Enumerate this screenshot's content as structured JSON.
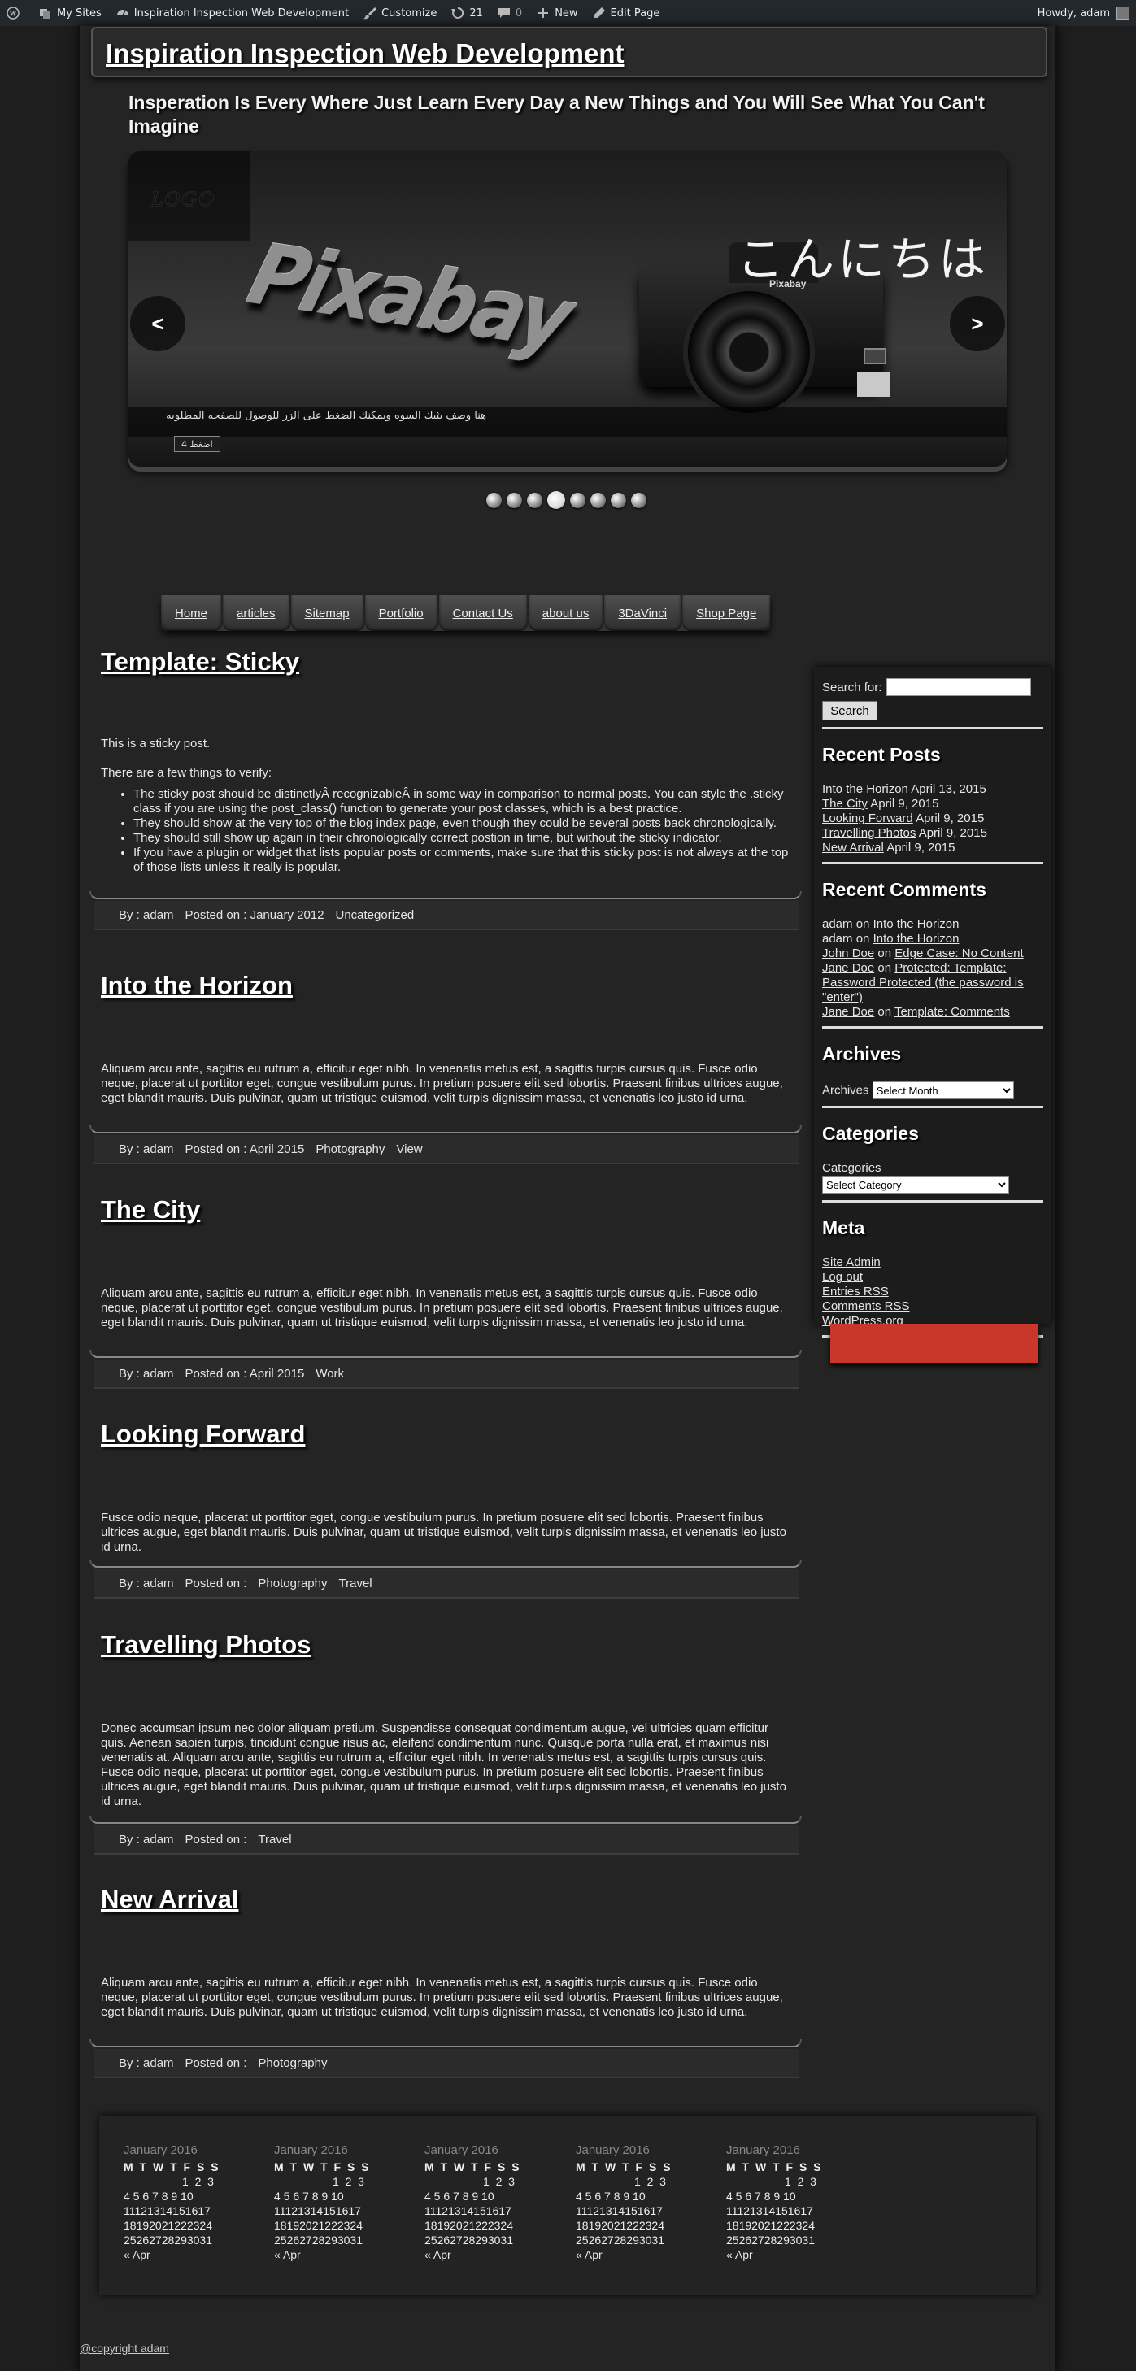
{
  "adminbar": {
    "items": [
      {
        "icon": "wordpress-icon",
        "label": ""
      },
      {
        "icon": "my-sites-icon",
        "label": "My Sites"
      },
      {
        "icon": "dashboard-icon",
        "label": "Inspiration Inspection Web Development"
      },
      {
        "icon": "brush-icon",
        "label": "Customize"
      },
      {
        "icon": "updates-icon",
        "label": "21"
      },
      {
        "icon": "comment-icon",
        "label": "0"
      },
      {
        "icon": "plus-icon",
        "label": "New"
      },
      {
        "icon": "pencil-icon",
        "label": "Edit Page"
      }
    ],
    "howdy": "Howdy, adam"
  },
  "site": {
    "title": "Inspiration Inspection Web Development",
    "tagline": "Insperation Is Every Where Just Learn Every Day a New Things and You Will See What You Can't Imagine"
  },
  "slider": {
    "logo": "LOGO",
    "brand": "Pixabay",
    "heading": "こんにちは",
    "prev": "<",
    "next": ">",
    "caption": "هنا وصف بثيك السوه ويمكنك الضغط على الزر للوصول للصفحه المطلوبه",
    "button": "اضغط 4",
    "dots_count": 8,
    "active_dot": 3
  },
  "nav": [
    "Home",
    "articles",
    "Sitemap",
    "Portfolio",
    "Contact Us",
    "about us",
    "3DaVinci",
    "Shop Page"
  ],
  "posts": [
    {
      "title": "Template: Sticky",
      "intro": "This is a sticky post.",
      "lead": "There are a few things to verify:",
      "bullets": [
        "The sticky post should be distinctlyÂ recognizableÂ in some way in comparison to normal posts. You can style the .sticky class if you are using the post_class() function to generate your post classes, which is a best practice.",
        "They should show at the very top of the blog index page, even though they could be several posts back chronologically.",
        "They should still show up again in their chronologically correct postion in time, but without the sticky indicator.",
        "If you have a plugin or widget that lists popular posts or comments, make sure that this sticky post is not always at the top of those lists unless it really is popular."
      ],
      "by": "By : adam",
      "posted": "Posted on : January 2012",
      "tags": [
        "Uncategorized"
      ]
    },
    {
      "title": "Into the Horizon",
      "body": "Aliquam arcu ante, sagittis eu rutrum a, efficitur eget nibh. In venenatis metus est, a sagittis turpis cursus quis. Fusce odio neque, placerat ut porttitor eget, congue vestibulum purus. In pretium posuere elit sed lobortis. Praesent finibus ultrices augue, eget blandit mauris. Duis pulvinar, quam ut tristique euismod, velit turpis dignissim massa, et venenatis leo justo id urna.",
      "by": "By : adam",
      "posted": "Posted on : April 2015",
      "tags": [
        "Photography",
        "View"
      ]
    },
    {
      "title": "The City",
      "body": "Aliquam arcu ante, sagittis eu rutrum a, efficitur eget nibh. In venenatis metus est, a sagittis turpis cursus quis. Fusce odio neque, placerat ut porttitor eget, congue vestibulum purus. In pretium posuere elit sed lobortis. Praesent finibus ultrices augue, eget blandit mauris. Duis pulvinar, quam ut tristique euismod, velit turpis dignissim massa, et venenatis leo justo id urna.",
      "by": "By : adam",
      "posted": "Posted on : April 2015",
      "tags": [
        "Work"
      ]
    },
    {
      "title": "Looking Forward",
      "body": "Fusce odio neque, placerat ut porttitor eget, congue vestibulum purus. In pretium posuere elit sed lobortis. Praesent finibus ultrices augue, eget blandit mauris. Duis pulvinar, quam ut tristique euismod, velit turpis dignissim massa, et venenatis leo justo id urna.",
      "by": "By : adam",
      "posted": "Posted on :",
      "tags": [
        "Photography",
        "Travel"
      ]
    },
    {
      "title": "Travelling Photos",
      "body": "Donec accumsan ipsum nec dolor aliquam pretium. Suspendisse consequat condimentum augue, vel ultricies quam efficitur quis. Aenean sapien turpis, tincidunt congue risus ac, eleifend condimentum nunc. Quisque porta nulla erat, et maximus nisi venenatis at. Aliquam arcu ante, sagittis eu rutrum a, efficitur eget nibh. In venenatis metus est, a sagittis turpis cursus quis. Fusce odio neque, placerat ut porttitor eget, congue vestibulum purus. In pretium posuere elit sed lobortis. Praesent finibus ultrices augue, eget blandit mauris. Duis pulvinar, quam ut tristique euismod, velit turpis dignissim massa, et venenatis leo justo id urna.",
      "by": "By : adam",
      "posted": "Posted on :",
      "tags": [
        "Travel"
      ]
    },
    {
      "title": "New Arrival",
      "body": "Aliquam arcu ante, sagittis eu rutrum a, efficitur eget nibh. In venenatis metus est, a sagittis turpis cursus quis. Fusce odio neque, placerat ut porttitor eget, congue vestibulum purus. In pretium posuere elit sed lobortis. Praesent finibus ultrices augue, eget blandit mauris. Duis pulvinar, quam ut tristique euismod, velit turpis dignissim massa, et venenatis leo justo id urna.",
      "by": "By : adam",
      "posted": "Posted on :",
      "tags": [
        "Photography"
      ]
    }
  ],
  "sidebar": {
    "search_label": "Search for:",
    "search_value": "",
    "search_button": "Search",
    "recent_posts_title": "Recent Posts",
    "recent_posts": [
      {
        "title": "Into the Horizon",
        "date": "April 13, 2015"
      },
      {
        "title": "The City",
        "date": "April 9, 2015"
      },
      {
        "title": "Looking Forward",
        "date": "April 9, 2015"
      },
      {
        "title": "Travelling Photos",
        "date": "April 9, 2015"
      },
      {
        "title": "New Arrival",
        "date": "April 9, 2015"
      }
    ],
    "recent_comments_title": "Recent Comments",
    "recent_comments": [
      {
        "author": "adam",
        "on": "on",
        "post": "Into the Horizon",
        "author_link": false
      },
      {
        "author": "adam",
        "on": "on",
        "post": "Into the Horizon",
        "author_link": false
      },
      {
        "author": "John Doe",
        "on": "on",
        "post": "Edge Case: No Content",
        "author_link": true
      },
      {
        "author": "Jane Doe",
        "on": "on",
        "post": "Protected: Template: Password Protected (the password is \"enter\")",
        "author_link": true
      },
      {
        "author": "Jane Doe",
        "on": "on",
        "post": "Template: Comments",
        "author_link": true
      }
    ],
    "archives_title": "Archives",
    "archives_label": "Archives",
    "archives_select": "Select Month",
    "categories_title": "Categories",
    "categories_label": "Categories",
    "categories_select": "Select Category",
    "meta_title": "Meta",
    "meta_links": [
      "Site Admin",
      "Log out",
      "Entries RSS",
      "Comments RSS",
      "WordPress.org"
    ]
  },
  "calendar": {
    "caption": "January 2016",
    "header": "M T W T F S S",
    "weeks": [
      "1  2  3",
      "4 5 6 7 8 9 10",
      "11121314151617",
      "18192021222324",
      "25262728293031"
    ],
    "prev": "« Apr",
    "count": 5
  },
  "footer": {
    "copyright": "@copyright adam"
  },
  "colors": {
    "background": "#1e1e1e",
    "panel": "#242424",
    "accent_red": "#c9362a",
    "adminbar": "#23282d"
  }
}
